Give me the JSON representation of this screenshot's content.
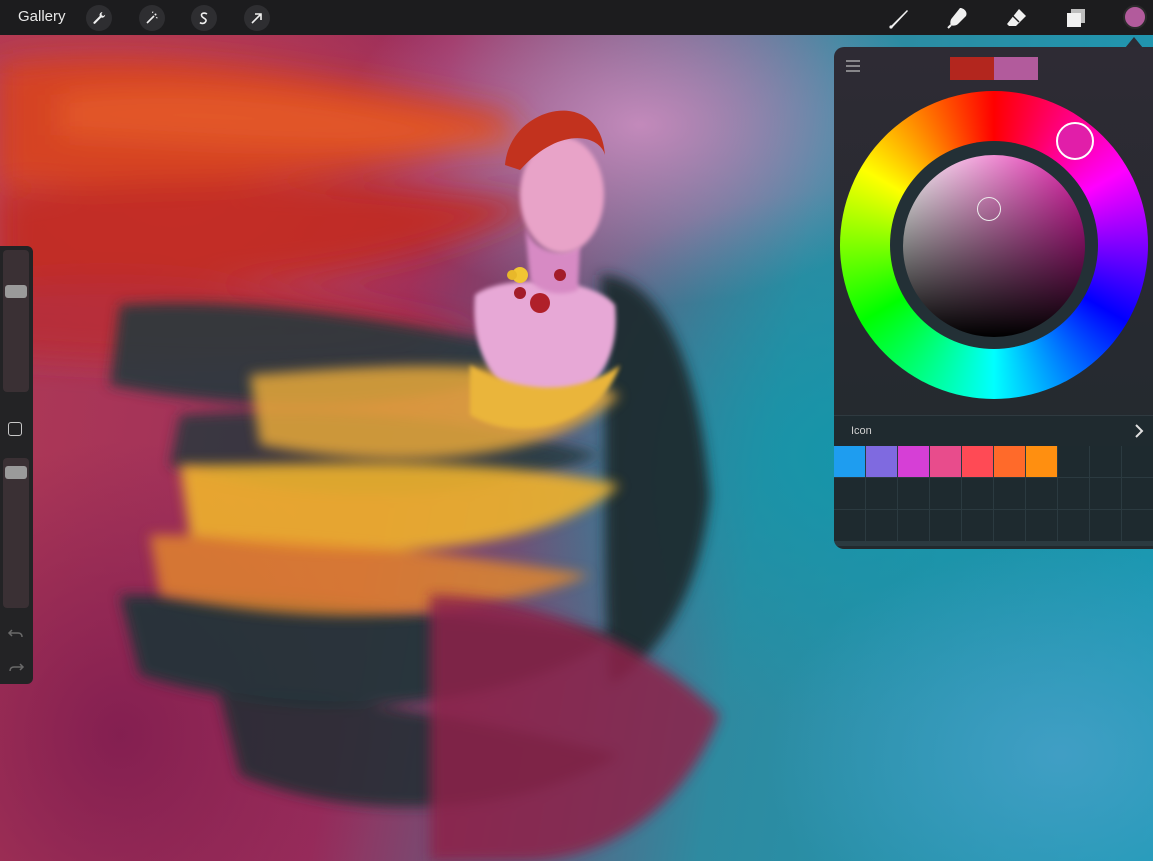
{
  "topbar": {
    "gallery_label": "Gallery",
    "left_tools": [
      "wrench-icon",
      "magic-wand-icon",
      "selection-s-icon",
      "transform-arrow-icon"
    ],
    "right_tools": [
      "brush-icon",
      "smudge-icon",
      "eraser-icon",
      "layers-icon"
    ],
    "active_color": "#b25b9c"
  },
  "sidebar": {
    "brush_size_level": 0.27,
    "opacity_level": 0.06
  },
  "color_panel": {
    "current_swatch": "#b3261e",
    "previous_swatch": "#b25b9c",
    "hue_wheel_selected_color": "#e11ea9",
    "palette": {
      "name": "Icon",
      "colors": [
        "#1e9df0",
        "#7f6ae0",
        "#d63fd6",
        "#e84c8c",
        "#ff4a55",
        "#ff6a2a",
        "#ff8f10"
      ]
    }
  }
}
